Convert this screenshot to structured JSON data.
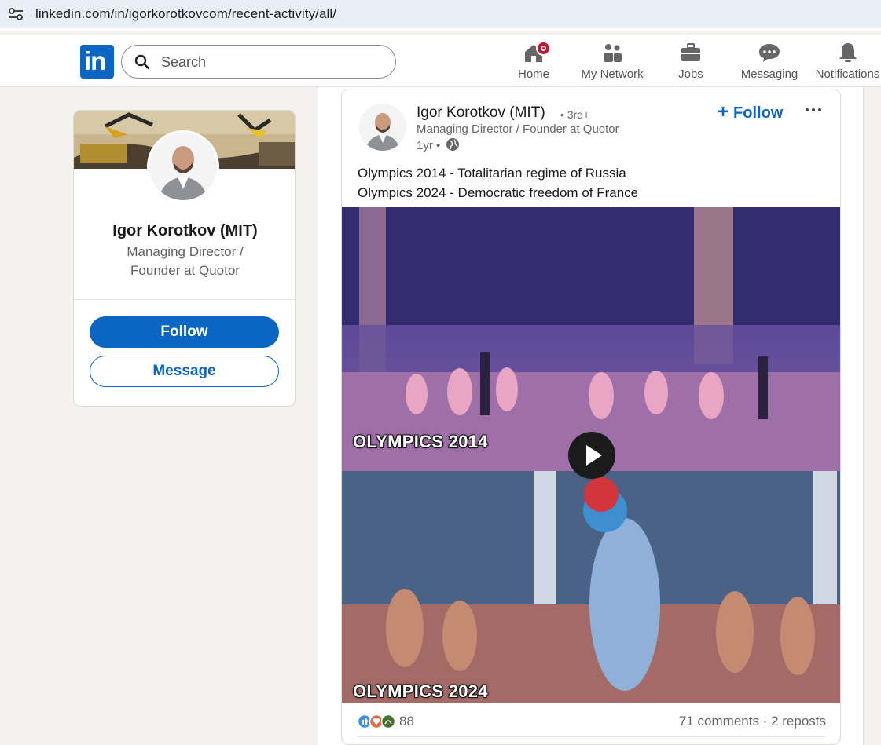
{
  "browser": {
    "url": "linkedin.com/in/igorkorotkovcom/recent-activity/all/"
  },
  "nav": {
    "logo": "in",
    "search_placeholder": "Search",
    "items": [
      {
        "label": "Home",
        "icon": "home-icon",
        "has_badge": true
      },
      {
        "label": "My Network",
        "icon": "network-icon"
      },
      {
        "label": "Jobs",
        "icon": "briefcase-icon"
      },
      {
        "label": "Messaging",
        "icon": "messaging-icon"
      },
      {
        "label": "Notifications",
        "icon": "bell-icon"
      }
    ]
  },
  "profile": {
    "name": "Igor Korotkov (MIT)",
    "headline": "Managing Director / Founder at Quotor",
    "follow_label": "Follow",
    "message_label": "Message"
  },
  "post": {
    "author_name": "Igor Korotkov (MIT)",
    "degree": "• 3rd+",
    "author_headline": "Managing Director / Founder at Quotor",
    "time": "1yr •",
    "follow_label": "Follow",
    "text_line1": "Olympics 2014 - Totalitarian regime of Russia",
    "text_line2": "Olympics 2024 - Democratic freedom of France",
    "video_caption_top": "OLYMPICS 2014",
    "video_caption_bottom": "OLYMPICS 2024",
    "reaction_count": "88",
    "comments_reposts": "71 comments · 2 reposts"
  },
  "colors": {
    "brand": "#0a66c2",
    "badge": "#cb112d",
    "background": "#f4f2ee"
  }
}
